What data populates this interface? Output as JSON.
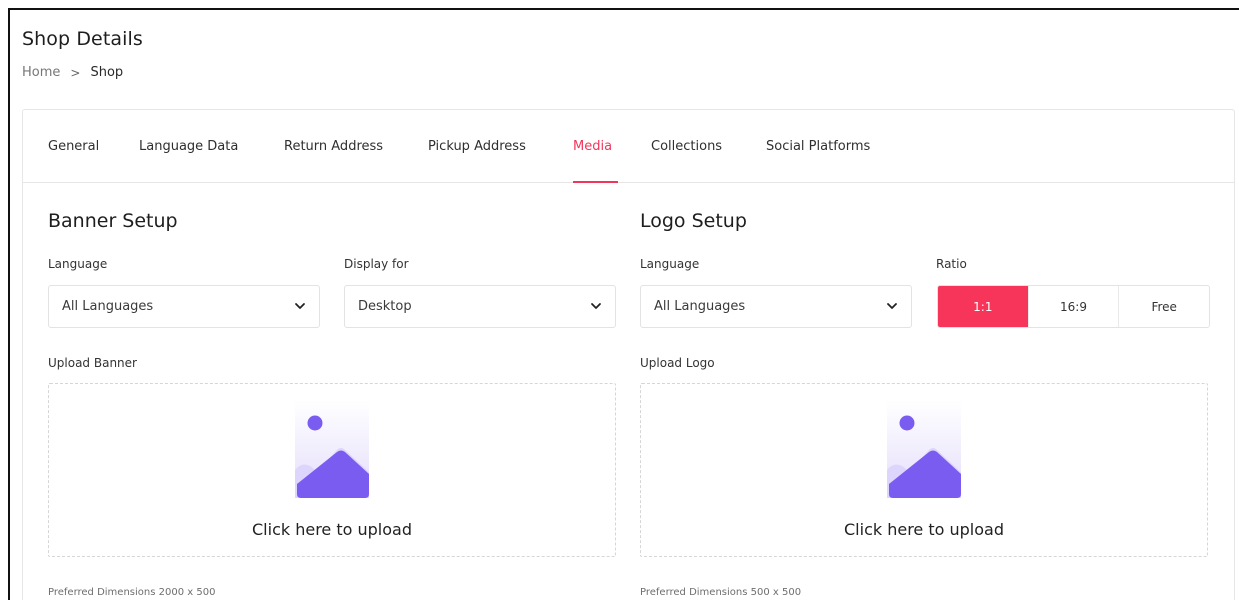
{
  "header": {
    "title": "Shop Details"
  },
  "breadcrumb": {
    "home": "Home",
    "separator": ">",
    "current": "Shop"
  },
  "tabs": [
    {
      "label": "General",
      "active": false
    },
    {
      "label": "Language Data",
      "active": false
    },
    {
      "label": "Return Address",
      "active": false
    },
    {
      "label": "Pickup Address",
      "active": false
    },
    {
      "label": "Media",
      "active": true
    },
    {
      "label": "Collections",
      "active": false
    },
    {
      "label": "Social Platforms",
      "active": false
    }
  ],
  "banner": {
    "title": "Banner Setup",
    "language_label": "Language",
    "language_value": "All Languages",
    "display_label": "Display for",
    "display_value": "Desktop",
    "upload_label": "Upload Banner",
    "upload_text": "Click here to upload",
    "hint": "Preferred Dimensions 2000 x 500"
  },
  "logo": {
    "title": "Logo Setup",
    "language_label": "Language",
    "language_value": "All Languages",
    "ratio_label": "Ratio",
    "ratio_options": [
      "1:1",
      "16:9",
      "Free"
    ],
    "ratio_selected": "1:1",
    "upload_label": "Upload Logo",
    "upload_text": "Click here to upload",
    "hint": "Preferred Dimensions 500 x 500"
  },
  "colors": {
    "accent": "#f73459",
    "illustration": "#7b5cf0"
  }
}
